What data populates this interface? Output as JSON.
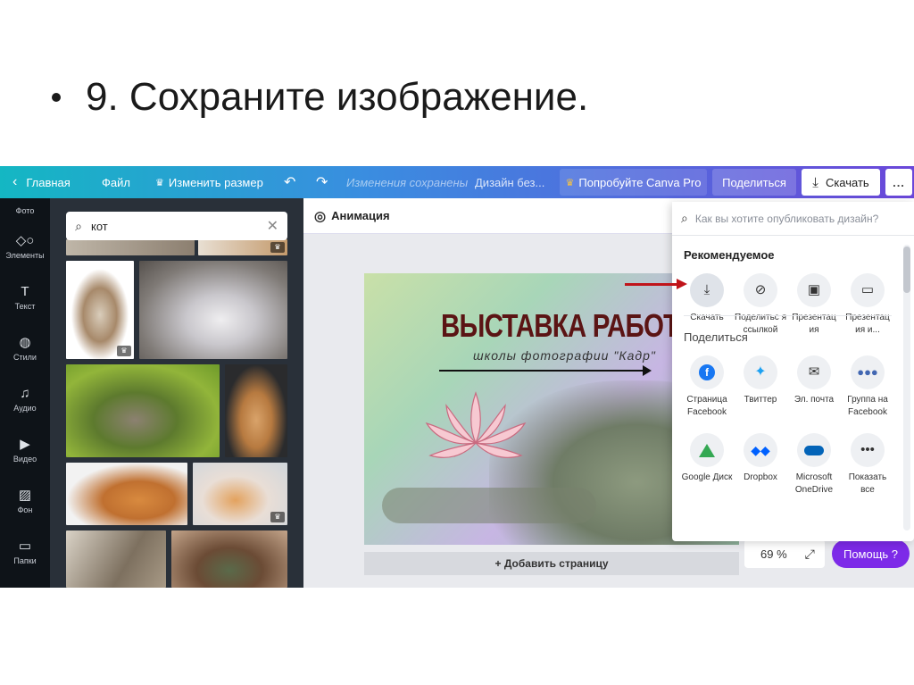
{
  "slide": {
    "title": "9. Сохраните изображение."
  },
  "topbar": {
    "home": "Главная",
    "file": "Файл",
    "resize": "Изменить размер",
    "saved": "Изменения сохранены",
    "design_name": "Дизайн без...",
    "pro": "Попробуйте Canva Pro",
    "share": "Поделиться",
    "download": "Скачать",
    "more": "..."
  },
  "rail": {
    "items": [
      {
        "label": "Фото",
        "icon": "photo-icon"
      },
      {
        "label": "Элементы",
        "icon": "elements-icon"
      },
      {
        "label": "Текст",
        "icon": "text-icon"
      },
      {
        "label": "Стили",
        "icon": "styles-icon"
      },
      {
        "label": "Аудио",
        "icon": "audio-icon"
      },
      {
        "label": "Видео",
        "icon": "video-icon"
      },
      {
        "label": "Фон",
        "icon": "background-icon"
      },
      {
        "label": "Папки",
        "icon": "folder-icon"
      }
    ]
  },
  "panel": {
    "search_value": "кот"
  },
  "editor": {
    "animation": "Анимация",
    "add_page": "+ Добавить страницу",
    "zoom": "69 %",
    "help": "Помощь ?"
  },
  "design": {
    "title": "ВЫСТАВКА РАБОТ",
    "subtitle": "школы фотографии \"Кадр\""
  },
  "publish": {
    "search_placeholder": "Как вы хотите опубликовать дизайн?",
    "recommended_title": "Рекомендуемое",
    "share_title": "Поделиться",
    "recommended": [
      {
        "label": "Скачать",
        "icon": "download-icon"
      },
      {
        "label": "Поделитьс я ссылкой",
        "icon": "link-icon"
      },
      {
        "label": "Презентац ия",
        "icon": "present-icon"
      },
      {
        "label": "Презентац ия и...",
        "icon": "present-record-icon"
      }
    ],
    "share": [
      {
        "label": "Страница Facebook",
        "icon": "facebook-icon"
      },
      {
        "label": "Твиттер",
        "icon": "twitter-icon"
      },
      {
        "label": "Эл. почта",
        "icon": "email-icon"
      },
      {
        "label": "Группа на Facebook",
        "icon": "facebook-group-icon"
      },
      {
        "label": "Google Диск",
        "icon": "google-drive-icon"
      },
      {
        "label": "Dropbox",
        "icon": "dropbox-icon"
      },
      {
        "label": "Microsoft OneDrive",
        "icon": "onedrive-icon"
      },
      {
        "label": "Показать все",
        "icon": "more-icon"
      }
    ]
  },
  "colors": {
    "accent": "#7d2ae8",
    "arrow": "#c0141a",
    "title_red": "#5b1414"
  }
}
